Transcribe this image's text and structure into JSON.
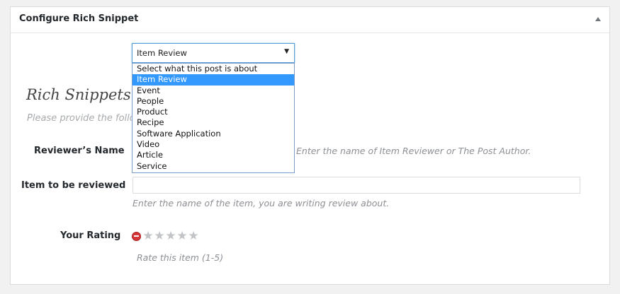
{
  "panel": {
    "title": "Configure Rich Snippet"
  },
  "type_select": {
    "value": "Item Review",
    "options": [
      "Select what this post is about",
      "Item Review",
      "Event",
      "People",
      "Product",
      "Recipe",
      "Software Application",
      "Video",
      "Article",
      "Service"
    ],
    "selected_index": 1
  },
  "section": {
    "title": "Rich Snippets -",
    "description": "Please provide the follo"
  },
  "fields": {
    "reviewer_name": {
      "label": "Reviewer’s Name",
      "hint": "Enter the name of Item Reviewer or The Post Author."
    },
    "item_reviewed": {
      "label": "Item to be reviewed",
      "value": "",
      "hint": "Enter the name of the item, you are writing review about."
    },
    "rating": {
      "label": "Your Rating",
      "value": 0,
      "max": 5,
      "hint": "Rate this item (1-5)"
    }
  },
  "colors": {
    "highlight": "#3399ff",
    "clear_rating": "#d63638",
    "star_empty": "#c3c4c7"
  }
}
